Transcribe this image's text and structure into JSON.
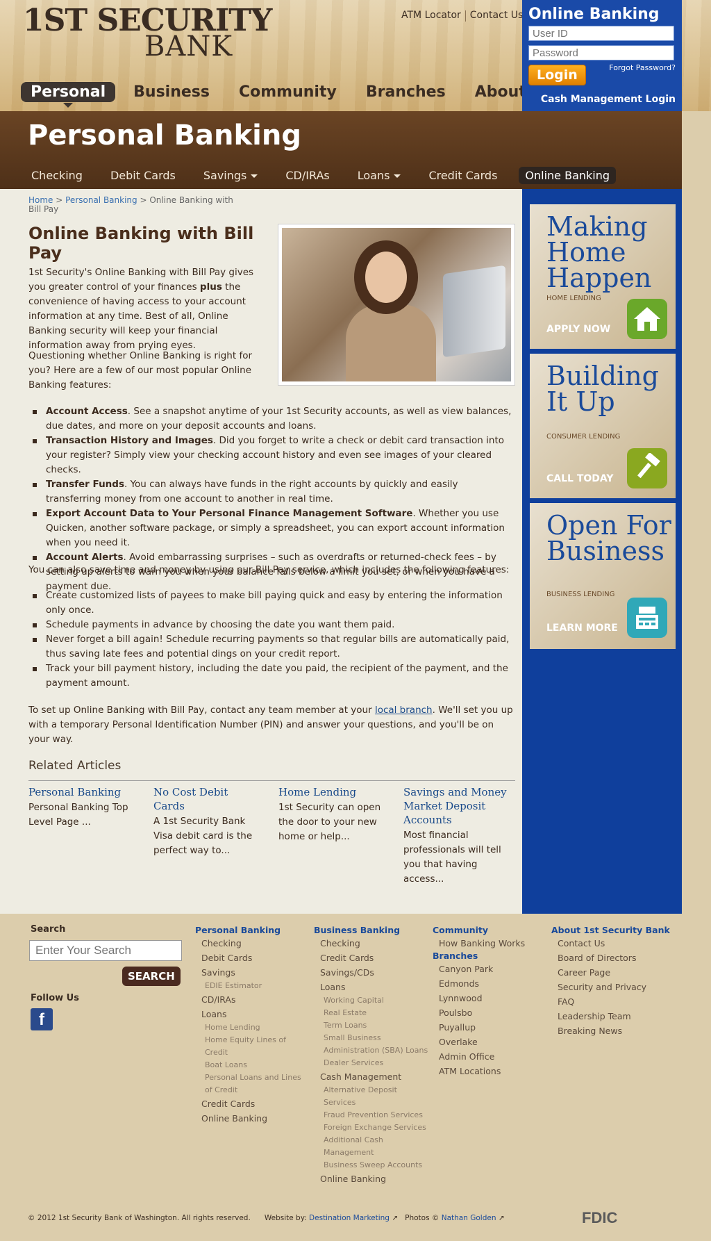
{
  "brand": {
    "line1": "1ST SECURITY",
    "line2": "BANK"
  },
  "top_links": [
    "ATM Locator",
    "Contact Us"
  ],
  "main_nav": [
    "Personal",
    "Business",
    "Community",
    "Branches",
    "About Us"
  ],
  "login": {
    "title": "Online Banking",
    "user_placeholder": "User ID",
    "password_placeholder": "Password",
    "forgot": "Forgot Password?",
    "button": "Login",
    "cash_mgmt": "Cash Management Login"
  },
  "band": {
    "title": "Personal Banking"
  },
  "sub_nav": [
    "Checking",
    "Debit Cards",
    "Savings",
    "CD/IRAs",
    "Loans",
    "Credit Cards",
    "Online Banking"
  ],
  "breadcrumb": {
    "home": "Home",
    "section": "Personal Banking",
    "current": "Online Banking with Bill Pay"
  },
  "article": {
    "title": "Online Banking with Bill Pay",
    "intro_pre": "1st Security's Online Banking with Bill Pay gives you greater control of your finances ",
    "intro_bold": "plus",
    "intro_post": " the convenience of having access to your account information at any time.  Best of all, Online Banking security will keep your financial information away from prying eyes.",
    "intro2": "Questioning whether Online Banking is right for you? Here are a few of our most popular Online Banking features:",
    "features": [
      {
        "bold": "Account Access",
        "text": ". See a snapshot anytime of your 1st Security accounts, as well as view balances, due dates, and more on your deposit accounts and loans."
      },
      {
        "bold": "Transaction History and Images",
        "text": ".  Did you forget to write a check or debit card transaction into your register?  Simply view your checking account history and even see images of your cleared checks."
      },
      {
        "bold": "Transfer Funds",
        "text": ".  You can always have funds in the right accounts by quickly and easily transferring money from one account to another in real time."
      },
      {
        "bold": "Export Account Data to Your Personal Finance Management Software",
        "text": ".  Whether you use Quicken, another software package, or simply a spreadsheet, you can export account information when you need it."
      },
      {
        "bold": "Account Alerts",
        "text": ".  Avoid embarrassing surprises – such as overdrafts or returned-check fees – by setting up alerts to warn you when your balance falls below a limit you set, or when you have a payment due."
      }
    ],
    "billpay_intro": "You can also save time and money by using our Bill Pay service, which includes the following features:",
    "billpay": [
      "Create customized lists of payees to make bill paying quick and easy by entering the information only once.",
      "Schedule payments in advance by choosing the date you want them paid.",
      "Never forget a bill again!  Schedule recurring payments so that regular bills are automatically paid, thus saving late fees and potential dings on your credit report.",
      "Track your bill payment history, including the date you paid, the recipient of the payment, and the payment amount."
    ],
    "setup_pre": "To set up Online Banking with Bill Pay, contact any team member at your ",
    "setup_link": "local branch",
    "setup_post": ". We'll set you up with a temporary Personal Identification Number (PIN) and answer your questions, and you'll be on your way."
  },
  "related": {
    "heading": "Related Articles",
    "items": [
      {
        "title": "Personal Banking",
        "text": "Personal Banking Top Level Page ..."
      },
      {
        "title": "No Cost Debit Cards",
        "text": "A 1st Security Bank Visa debit card is the perfect way to..."
      },
      {
        "title": "Home Lending",
        "text": "1st Security can open the door to your new home or help..."
      },
      {
        "title": "Savings and Money Market Deposit Accounts",
        "text": "Most financial professionals will tell you that having access..."
      }
    ]
  },
  "promos": [
    {
      "title": "Making Home Happen",
      "label": "HOME LENDING",
      "cta": "APPLY NOW",
      "icon": "house-icon",
      "color": "#6aa82a"
    },
    {
      "title": "Building It Up",
      "label": "CONSUMER LENDING",
      "cta": "CALL TODAY",
      "icon": "hammer-icon",
      "color": "#8aa820"
    },
    {
      "title": "Open For Business",
      "label": "BUSINESS LENDING",
      "cta": "LEARN MORE",
      "icon": "cash-register-icon",
      "color": "#30a8b8"
    }
  ],
  "footer": {
    "search_label": "Search",
    "search_placeholder": "Enter Your Search",
    "search_button": "SEARCH",
    "follow": "Follow Us",
    "facebook": "f",
    "personal": {
      "heading": "Personal Banking",
      "items": [
        {
          "t": "Checking",
          "l": 1
        },
        {
          "t": "Debit Cards",
          "l": 1
        },
        {
          "t": "Savings",
          "l": 1
        },
        {
          "t": "EDIE Estimator",
          "l": 2
        },
        {
          "t": "CD/IRAs",
          "l": 1
        },
        {
          "t": "Loans",
          "l": 1
        },
        {
          "t": "Home Lending",
          "l": 2
        },
        {
          "t": "Home Equity Lines of Credit",
          "l": 2
        },
        {
          "t": "Boat Loans",
          "l": 2
        },
        {
          "t": "Personal Loans and Lines of Credit",
          "l": 2
        },
        {
          "t": "Credit Cards",
          "l": 1
        },
        {
          "t": "Online Banking",
          "l": 1
        }
      ]
    },
    "business": {
      "heading": "Business Banking",
      "items": [
        {
          "t": "Checking",
          "l": 1
        },
        {
          "t": "Credit Cards",
          "l": 1
        },
        {
          "t": "Savings/CDs",
          "l": 1
        },
        {
          "t": "Loans",
          "l": 1
        },
        {
          "t": "Working Capital",
          "l": 2
        },
        {
          "t": "Real Estate",
          "l": 2
        },
        {
          "t": "Term Loans",
          "l": 2
        },
        {
          "t": "Small Business Administration (SBA) Loans",
          "l": 2
        },
        {
          "t": "Dealer Services",
          "l": 2
        },
        {
          "t": "Cash Management",
          "l": 1
        },
        {
          "t": "Alternative Deposit Services",
          "l": 2
        },
        {
          "t": "Fraud Prevention Services",
          "l": 2
        },
        {
          "t": "Foreign Exchange Services",
          "l": 2
        },
        {
          "t": "Additional Cash Management",
          "l": 2
        },
        {
          "t": "Business Sweep Accounts",
          "l": 2
        },
        {
          "t": "Online Banking",
          "l": 1
        }
      ]
    },
    "community": {
      "heading": "Community",
      "items": [
        {
          "t": "How Banking Works",
          "l": 1
        }
      ],
      "branches_heading": "Branches",
      "branches": [
        "Canyon Park",
        "Edmonds",
        "Lynnwood",
        "Poulsbo",
        "Puyallup",
        "Overlake",
        "Admin Office",
        "ATM Locations"
      ]
    },
    "about": {
      "heading": "About 1st Security Bank",
      "items": [
        "Contact Us",
        "Board of Directors",
        "Career Page",
        "Security and Privacy",
        "FAQ",
        "Leadership Team",
        "Breaking News"
      ]
    },
    "copyright": "© 2012 1st Security Bank of Washington. All rights reserved.",
    "website_by": "Website by:",
    "website_link": "Destination Marketing",
    "photos": "Photos ©",
    "photos_link": "Nathan Golden",
    "fdic": "FDIC"
  }
}
